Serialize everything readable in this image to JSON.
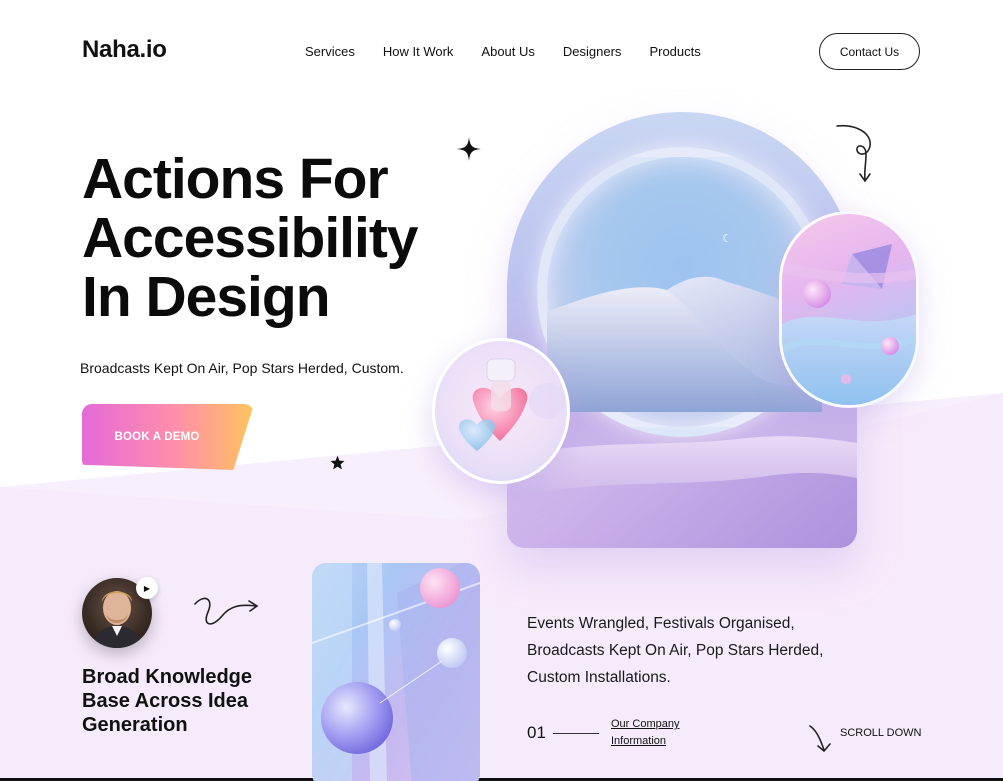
{
  "header": {
    "logo": "Naha.io",
    "nav": [
      "Services",
      "How It Work",
      "About Us",
      "Designers",
      "Products"
    ],
    "contact_label": "Contact Us"
  },
  "hero": {
    "title_lines": [
      "Actions For",
      "Accessibility",
      "In Design"
    ],
    "subtitle": "Broadcasts Kept On Air, Pop Stars Herded, Custom.",
    "cta_label": "BOOK A DEMO"
  },
  "lower": {
    "heading_lines": [
      "Broad Knowledge",
      "Base Across Idea",
      "Generation"
    ],
    "events_text": "Events Wrangled, Festivals Organised, Broadcasts Kept On Air, Pop Stars Herded, Custom Installations.",
    "counter": "01",
    "link_lines": [
      "Our Company",
      "Information"
    ],
    "scroll_label": "SCROLL DOWN"
  },
  "colors": {
    "lavender_bg": "#f7ecfc",
    "cta_start": "#e46ad8",
    "cta_end": "#ffc45c",
    "text": "#111111"
  }
}
